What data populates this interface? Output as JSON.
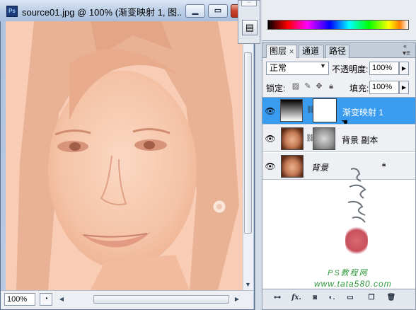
{
  "document": {
    "app_icon_text": "Ps",
    "title": "source01.jpg @ 100% (渐变映射 1, 图...",
    "zoom": "100%",
    "canvas_tint": "#f7c6ad"
  },
  "swatches": {
    "spectrum_colors": [
      "#000000",
      "#ff0000",
      "#ff00ff",
      "#0000ff",
      "#00ffff",
      "#00ff00",
      "#ffff00",
      "#ffffff"
    ]
  },
  "layers_panel": {
    "tabs": [
      {
        "label": "图层",
        "active": true
      },
      {
        "label": "通道",
        "active": false
      },
      {
        "label": "路径",
        "active": false
      }
    ],
    "blend_mode": "正常",
    "opacity_label": "不透明度:",
    "opacity_value": "100%",
    "lock_label": "锁定:",
    "fill_label": "填充:",
    "fill_value": "100%",
    "layers": [
      {
        "name": "渐变映射 1",
        "selected": true,
        "visible": true
      },
      {
        "name": "背景 副本",
        "selected": false,
        "visible": true
      },
      {
        "name": "背景",
        "selected": false,
        "visible": true,
        "locked": true
      }
    ],
    "selected_color": "#3a9cf0"
  },
  "watermark": {
    "ps_text": "PS教程网",
    "url_text": "www.tata580.com"
  }
}
